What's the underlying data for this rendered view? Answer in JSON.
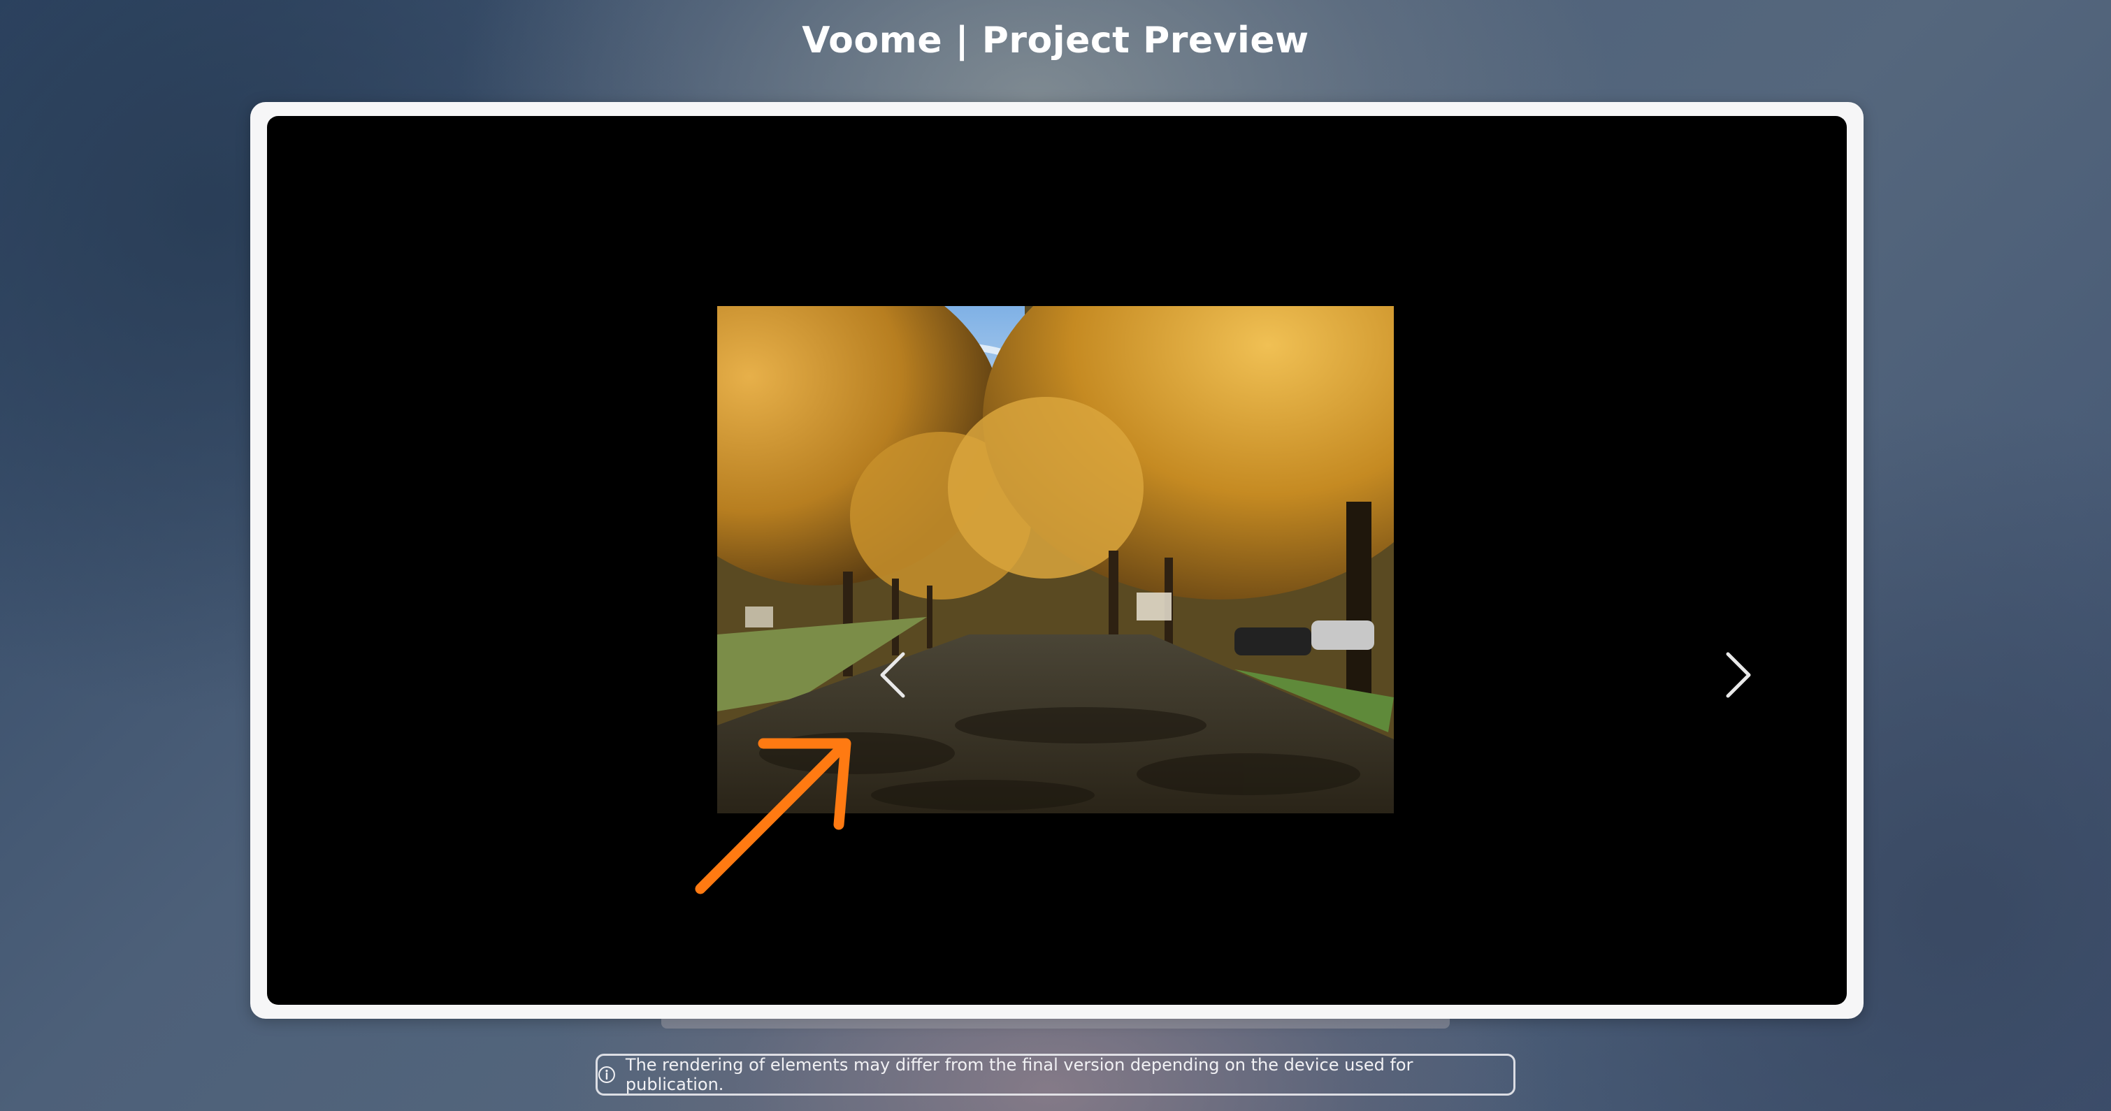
{
  "app": {
    "title": "Voome | Project Preview"
  },
  "preview": {
    "slide_image": "autumn tree-lined street photo",
    "prev_icon": "chevron-left-icon",
    "next_icon": "chevron-right-icon"
  },
  "annotation": {
    "icon": "arrow-up-right-icon",
    "color": "#ff7a12"
  },
  "notice": {
    "icon": "info-circle-icon",
    "text": "The rendering of elements may differ from the final version depending on the device used for publication."
  },
  "colors": {
    "frame": "#f6f6f7",
    "screen": "#000000",
    "title_text": "#ffffff"
  }
}
